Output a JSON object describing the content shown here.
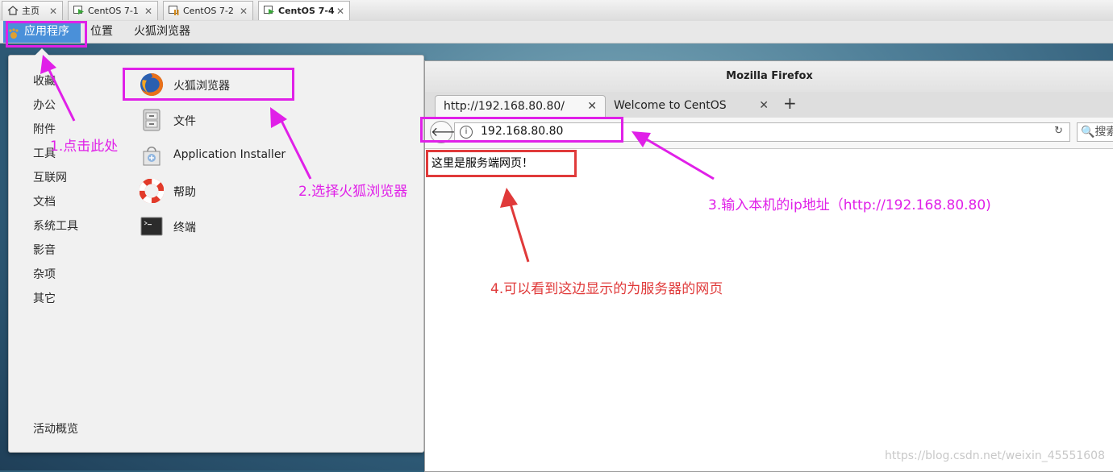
{
  "vm_tabs": [
    {
      "label": "主页",
      "active": false
    },
    {
      "label": "CentOS 7-1",
      "active": false
    },
    {
      "label": "CentOS 7-2",
      "active": false
    },
    {
      "label": "CentOS 7-4",
      "active": true
    }
  ],
  "topbar": {
    "applications": "应用程序",
    "places": "位置",
    "running_app": "火狐浏览器"
  },
  "apps_menu": {
    "categories": [
      "收藏",
      "办公",
      "附件",
      "工具",
      "互联网",
      "文档",
      "系统工具",
      "影音",
      "杂项",
      "其它"
    ],
    "activities": "活动概览",
    "apps": [
      {
        "label": "火狐浏览器",
        "icon": "firefox-icon"
      },
      {
        "label": "文件",
        "icon": "file-cabinet-icon"
      },
      {
        "label": "Application Installer",
        "icon": "app-installer-icon"
      },
      {
        "label": "帮助",
        "icon": "lifebuoy-help-icon"
      },
      {
        "label": "终端",
        "icon": "terminal-icon"
      }
    ]
  },
  "firefox": {
    "title": "Mozilla Firefox",
    "tabs": [
      {
        "label": "http://192.168.80.80/",
        "active": true
      },
      {
        "label": "Welcome to CentOS",
        "active": false
      }
    ],
    "newtab": "+",
    "url": "192.168.80.80",
    "search_placeholder": "搜索",
    "page_text": "这里是服务端网页！"
  },
  "annotations": {
    "step1": "1.点击此处",
    "step2": "2.选择火狐浏览器",
    "step3": "3.输入本机的ip地址（http://192.168.80.80)",
    "step4": "4.可以看到这边显示的为服务器的网页",
    "magenta": "#e020e8",
    "red": "#e03a3a"
  },
  "watermark": "https://blog.csdn.net/weixin_45551608"
}
